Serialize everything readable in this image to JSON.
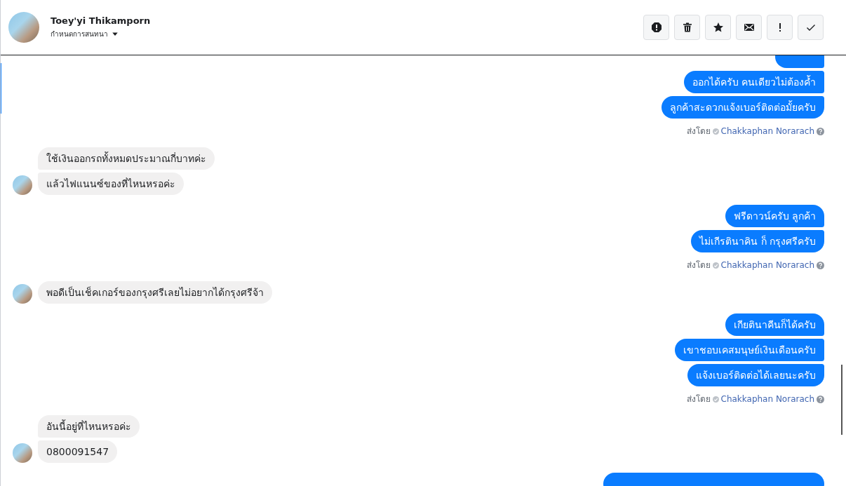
{
  "header": {
    "name": "Toey'yi Thikamporn",
    "subtitle": "กำหนดการสนทนา"
  },
  "toolbar": [
    {
      "kind": "alert"
    },
    {
      "kind": "trash"
    },
    {
      "kind": "star"
    },
    {
      "kind": "mail"
    },
    {
      "kind": "bang"
    },
    {
      "kind": "check"
    }
  ],
  "groups": [
    {
      "kind": "outgoing",
      "messages": [
        {
          "cut": true
        },
        {
          "cut": false,
          "text": "ออกได้ครับ คนเดียวไม่ต้องค้ำ"
        },
        {
          "cut": false,
          "text": "ลูกค้าสะดวกแจ้งเบอร์ติดต่อมั้ยครับ"
        }
      ],
      "sent_label": "ส่งโดย",
      "sent_by": "Chakkaphan Norarach"
    },
    {
      "kind": "incoming",
      "messages": [
        {
          "cut": false,
          "text": "ใช้เงินออกรถทั้งหมดประมาณกี่บาทค่ะ"
        },
        {
          "cut": false,
          "text": "แล้วไฟแนนซ์ของที่ไหนหรอค่ะ"
        }
      ]
    },
    {
      "kind": "outgoing",
      "messages": [
        {
          "cut": false,
          "text": "ฟรีดาวน์ครับ ลูกค้า"
        },
        {
          "cut": false,
          "text": "ไม่เกีรตินาคิน ก็ กรุงศรีครับ"
        }
      ],
      "sent_label": "ส่งโดย",
      "sent_by": "Chakkaphan Norarach"
    },
    {
      "kind": "incoming",
      "messages": [
        {
          "cut": false,
          "text": "พอดีเป็นเช็คเกอร์ของกรุงศรีเลยไม่อยากได้กรุงศรีจ้า"
        }
      ]
    },
    {
      "kind": "outgoing",
      "messages": [
        {
          "cut": false,
          "text": "เกียตินาคีนก็ได้ครับ"
        },
        {
          "cut": false,
          "text": "เขาชอบเคสมนุษย์เงินเดือนครับ"
        },
        {
          "cut": false,
          "text": "แจ้งเบอร์ติดต่อได้เลยนะครับ"
        }
      ],
      "sent_label": "ส่งโดย",
      "sent_by": "Chakkaphan Norarach"
    },
    {
      "kind": "incoming",
      "messages": [
        {
          "cut": false,
          "text": "อันนี้อยู่ที่ไหนหรอค่ะ"
        },
        {
          "cut": false,
          "text": "0800091547"
        }
      ]
    },
    {
      "kind": "outgoing",
      "messages": [
        {
          "cut": true
        }
      ]
    }
  ]
}
